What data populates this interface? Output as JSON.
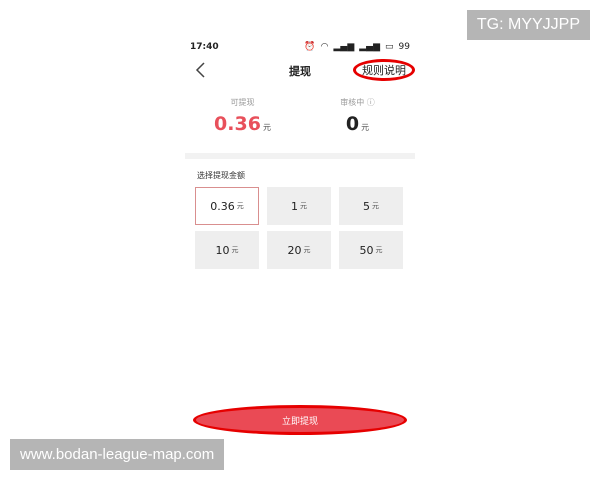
{
  "watermarks": {
    "top_right": "TG: MYYJJPP",
    "bottom_left": "www.bodan-league-map.com"
  },
  "status_bar": {
    "time": "17:40",
    "battery": "99",
    "icons": [
      "alarm-icon",
      "wifi-icon",
      "signal-icon",
      "signal-icon",
      "battery-icon"
    ]
  },
  "nav": {
    "title": "提现",
    "rules_label": "规则说明",
    "back_icon": "chevron-left-icon"
  },
  "balances": {
    "available": {
      "label": "可提现",
      "value": "0.36",
      "unit": "元"
    },
    "reviewing": {
      "label": "审核中",
      "value": "0",
      "unit": "元",
      "info_icon": "question-circle-icon"
    }
  },
  "amount_section": {
    "label": "选择提现金额",
    "options": [
      {
        "value": "0.36",
        "unit": "元",
        "selected": true
      },
      {
        "value": "1",
        "unit": "元",
        "selected": false
      },
      {
        "value": "5",
        "unit": "元",
        "selected": false
      },
      {
        "value": "10",
        "unit": "元",
        "selected": false
      },
      {
        "value": "20",
        "unit": "元",
        "selected": false
      },
      {
        "value": "50",
        "unit": "元",
        "selected": false
      }
    ]
  },
  "action": {
    "label": "立即提现"
  },
  "colors": {
    "accent": "#e8505b",
    "highlight": "#e60000"
  }
}
